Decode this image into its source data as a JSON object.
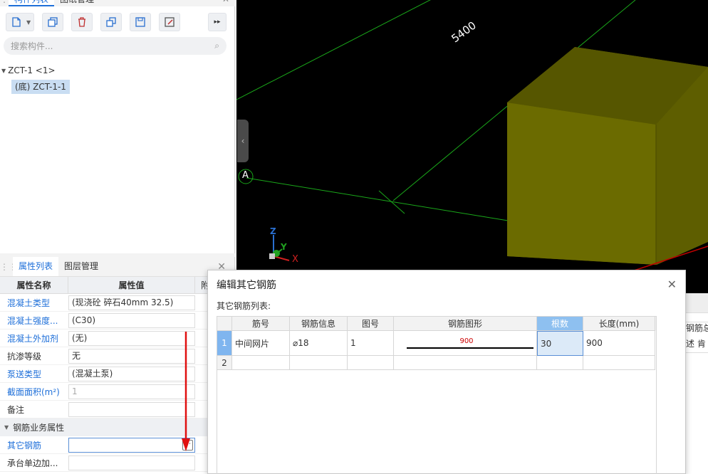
{
  "top_panel": {
    "tabs": [
      "构件列表",
      "图纸管理"
    ],
    "search_placeholder": "搜索构件...",
    "tree": {
      "root": "ZCT-1 <1>",
      "child": "(底) ZCT-1-1"
    }
  },
  "viewport": {
    "dimension_label": "5400",
    "axis_label": "A",
    "axes": {
      "z": "Z",
      "y": "Y",
      "x": "X"
    },
    "colors": {
      "background": "#000000",
      "grid": "#1aa81a",
      "block": "#6b6b00"
    }
  },
  "property_panel": {
    "tabs": [
      "属性列表",
      "图层管理"
    ],
    "header": {
      "name": "属性名称",
      "value": "属性值",
      "extra": "附"
    },
    "rows": [
      {
        "name": "混凝土类型",
        "value": "(现浇砼 碎石40mm 32.5)"
      },
      {
        "name": "混凝土强度...",
        "value": "(C30)"
      },
      {
        "name": "混凝土外加剂",
        "value": "(无)"
      },
      {
        "name": "抗渗等级",
        "value": "无"
      },
      {
        "name": "泵送类型",
        "value": "(混凝土泵)"
      },
      {
        "name": "截面面积(m²)",
        "value": "1"
      },
      {
        "name": "备注",
        "value": ""
      }
    ],
    "group": "钢筋业务属性",
    "group_rows": [
      {
        "name": "其它钢筋",
        "value": ""
      },
      {
        "name": "承台单边加...",
        "value": ""
      }
    ]
  },
  "right_fragment": {
    "line1": "钢筋总",
    "line2": "述 肯"
  },
  "dialog": {
    "title": "编辑其它钢筋",
    "subtitle": "其它钢筋列表:",
    "columns": [
      "筋号",
      "钢筋信息",
      "图号",
      "钢筋图形",
      "根数",
      "长度(mm)"
    ],
    "rows": [
      {
        "num": "1",
        "bar": "中间网片",
        "info": "⌀18",
        "fig": "1",
        "shape_label": "900",
        "count": "30",
        "length": "900"
      },
      {
        "num": "2",
        "bar": "",
        "info": "",
        "fig": "",
        "shape_label": "",
        "count": "",
        "length": ""
      }
    ]
  }
}
